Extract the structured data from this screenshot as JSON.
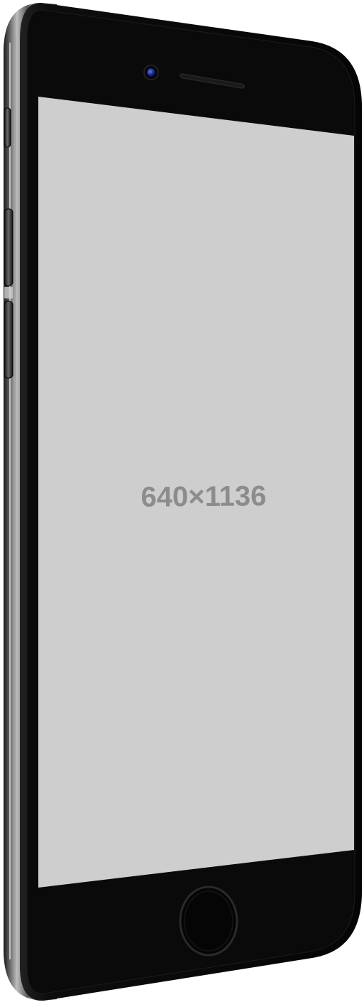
{
  "device": {
    "model": "smartphone",
    "finish": "jet-black",
    "body_color": "#0b0b0b",
    "bezel_color": "#0a0a0a",
    "camera_lens_color": "#2035a8",
    "home_button_ring_color": "#2a2a2a"
  },
  "screen": {
    "background_color": "#cecece",
    "placeholder_text": "640×1136",
    "placeholder_text_color": "#8c8c8c"
  }
}
